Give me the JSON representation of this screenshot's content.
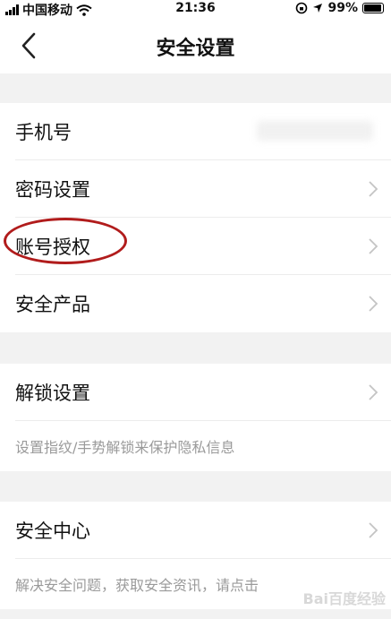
{
  "status_bar": {
    "carrier": "中国移动",
    "time": "21:36",
    "battery": "99%"
  },
  "header": {
    "title": "安全设置"
  },
  "section1": {
    "items": [
      {
        "label": "手机号"
      },
      {
        "label": "密码设置"
      },
      {
        "label": "账号授权"
      },
      {
        "label": "安全产品"
      }
    ]
  },
  "section2": {
    "item": {
      "label": "解锁设置"
    },
    "description": "设置指纹/手势解锁来保护隐私信息"
  },
  "section3": {
    "item": {
      "label": "安全中心"
    },
    "description": "解决安全问题，获取安全资讯，请点击"
  },
  "watermark": "Bai百度经验",
  "colors": {
    "annotation_circle": "#b11c1c",
    "background": "#f2f2f2"
  }
}
